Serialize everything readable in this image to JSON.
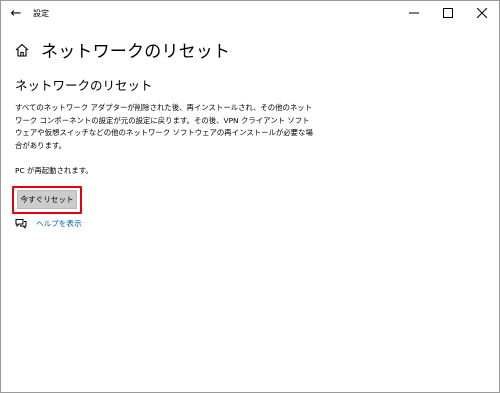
{
  "window": {
    "title": "設定",
    "back_icon": "←",
    "minimize_icon": "—",
    "maximize_icon": "☐",
    "close_icon": "✕"
  },
  "header": {
    "title": "ネットワークのリセット"
  },
  "main": {
    "section_title": "ネットワークのリセット",
    "description_lines": [
      "すべてのネットワーク アダプターが削除された後、再インストールされ、その他のネット",
      "ワーク コンポーネントの設定が元の設定に戻ります。その後、VPN クライアント ソフト",
      "ウェアや仮想スイッチなどの他のネットワーク ソフトウェアの再インストールが必要な場",
      "合があります。"
    ],
    "restart_note": "PC が再起動されます。",
    "reset_button_label": "今すぐリセット",
    "help_link_label": "ヘルプを表示"
  },
  "colors": {
    "accent_link": "#0066b4",
    "highlight_border": "#e60012",
    "button_bg": "#cccccc"
  }
}
